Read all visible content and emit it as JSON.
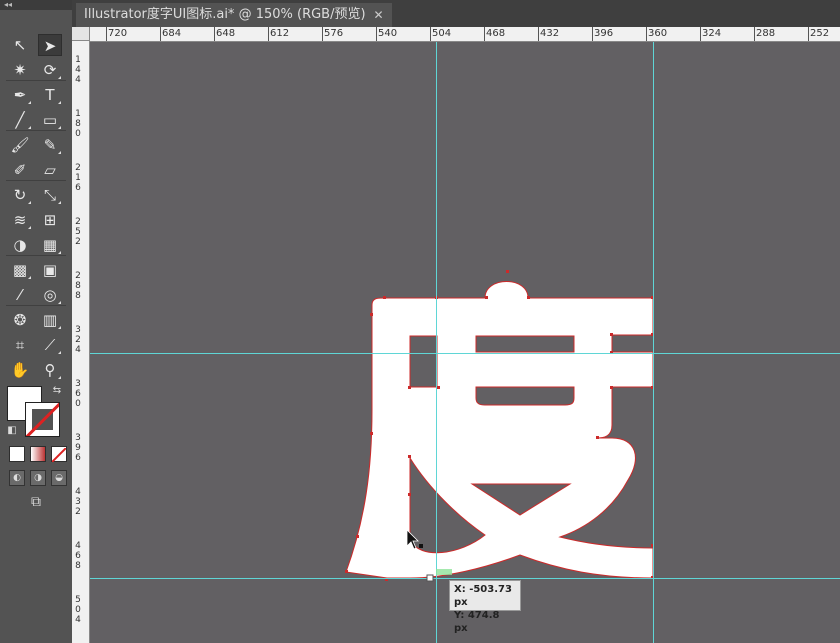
{
  "app": {
    "panel_collapse": "◂◂"
  },
  "document": {
    "tab_title": "Illustrator度字UI图标.ai* @ 150% (RGB/预览)",
    "tab_close": "✕"
  },
  "ruler": {
    "horizontal": [
      "720",
      "684",
      "648",
      "612",
      "576",
      "540",
      "504",
      "468",
      "432",
      "396",
      "360",
      "324",
      "288",
      "252"
    ],
    "vertical": [
      "144",
      "180",
      "216",
      "252",
      "288",
      "324",
      "360",
      "396",
      "432",
      "468",
      "504"
    ]
  },
  "artwork": {
    "glyph": "度",
    "fill": "#ffffff",
    "path_color": "#cc2a2a",
    "guide_color": "#5fd6d6"
  },
  "cursor_readout": {
    "x": "X: -503.73 px",
    "y": "Y: 474.8 px"
  },
  "tools": [
    {
      "id": "selection-tool",
      "glyph": "↖"
    },
    {
      "id": "direct-selection-tool",
      "glyph": "➤"
    },
    {
      "id": "magic-wand-tool",
      "glyph": "✷"
    },
    {
      "id": "lasso-tool",
      "glyph": "⟳"
    },
    {
      "id": "pen-tool",
      "glyph": "✒"
    },
    {
      "id": "type-tool",
      "glyph": "T"
    },
    {
      "id": "line-segment-tool",
      "glyph": "╱"
    },
    {
      "id": "rectangle-tool",
      "glyph": "▭"
    },
    {
      "id": "paintbrush-tool",
      "glyph": "🖌"
    },
    {
      "id": "pencil-tool",
      "glyph": "✎"
    },
    {
      "id": "blob-brush-tool",
      "glyph": "✐"
    },
    {
      "id": "eraser-tool",
      "glyph": "▱"
    },
    {
      "id": "rotate-tool",
      "glyph": "↻"
    },
    {
      "id": "scale-tool",
      "glyph": "⤡"
    },
    {
      "id": "width-tool",
      "glyph": "≋"
    },
    {
      "id": "free-transform-tool",
      "glyph": "⊞"
    },
    {
      "id": "shape-builder-tool",
      "glyph": "◑"
    },
    {
      "id": "perspective-grid-tool",
      "glyph": "▦"
    },
    {
      "id": "mesh-tool",
      "glyph": "▩"
    },
    {
      "id": "gradient-tool",
      "glyph": "▣"
    },
    {
      "id": "eyedropper-tool",
      "glyph": "⁄"
    },
    {
      "id": "blend-tool",
      "glyph": "◎"
    },
    {
      "id": "symbol-sprayer-tool",
      "glyph": "❂"
    },
    {
      "id": "column-graph-tool",
      "glyph": "▥"
    },
    {
      "id": "artboard-tool",
      "glyph": "⌗"
    },
    {
      "id": "slice-tool",
      "glyph": "⟋"
    },
    {
      "id": "hand-tool",
      "glyph": "✋"
    },
    {
      "id": "zoom-tool",
      "glyph": "⚲"
    }
  ],
  "colors": {
    "fill": "#ffffff",
    "stroke": "none",
    "canvas": "#626063",
    "ui": "#535353"
  }
}
